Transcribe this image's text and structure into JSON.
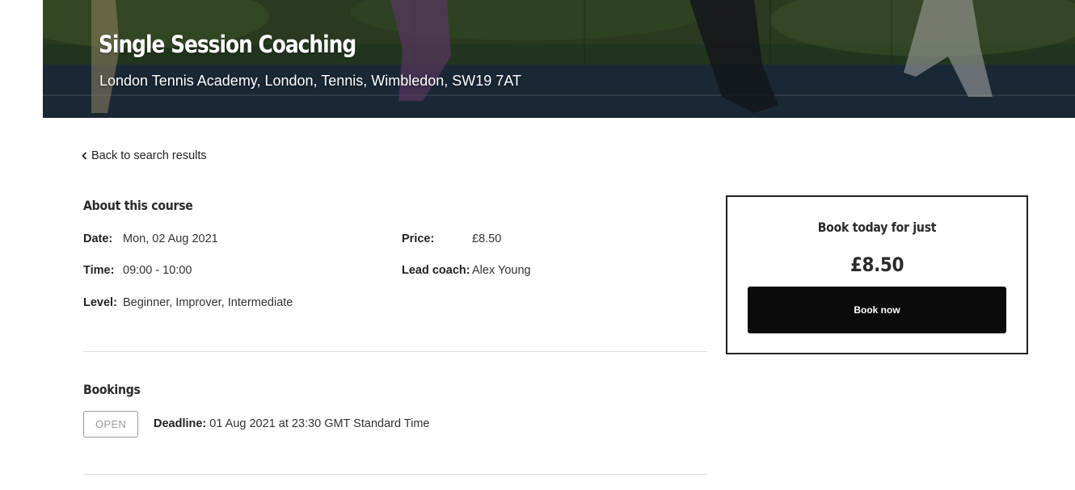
{
  "hero": {
    "title": "Single Session Coaching",
    "subtitle": "London Tennis Academy, London, Tennis, Wimbledon, SW19 7AT"
  },
  "nav": {
    "back_label": "Back to search results"
  },
  "about": {
    "heading": "About this course",
    "date_label": "Date:",
    "date_value": "Mon, 02 Aug 2021",
    "time_label": "Time:",
    "time_value": "09:00 - 10:00",
    "level_label": "Level:",
    "level_value": "Beginner, Improver, Intermediate",
    "price_label": "Price:",
    "price_value": "£8.50",
    "coach_label": "Lead coach:",
    "coach_value": "Alex Young"
  },
  "bookings": {
    "heading": "Bookings",
    "status": "OPEN",
    "deadline_label": "Deadline:",
    "deadline_value": "01 Aug 2021 at 23:30 GMT Standard Time"
  },
  "book_box": {
    "title": "Book today for just",
    "price": "£8.50",
    "button_label": "Book now"
  },
  "colors": {
    "button_bg": "#0b0b0b",
    "badge_border": "#9a9a9a",
    "divider": "#dcdcdc"
  }
}
